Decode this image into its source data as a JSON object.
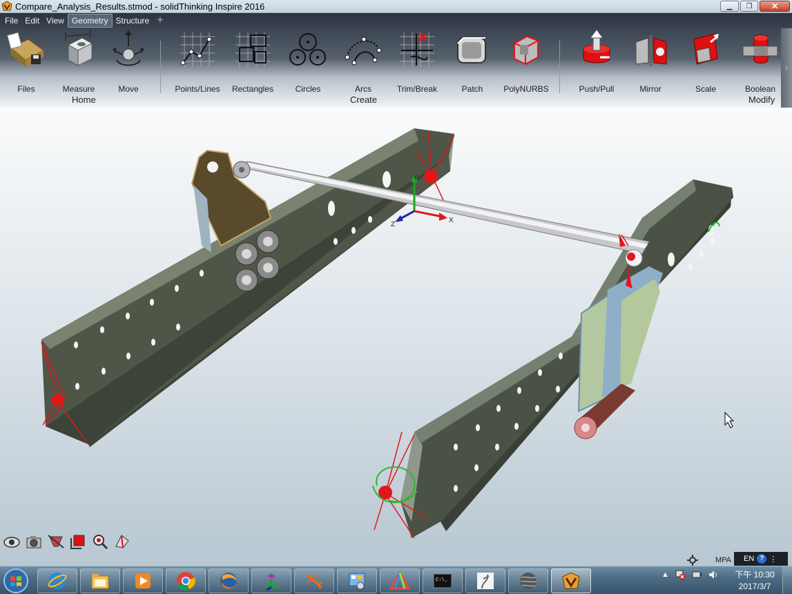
{
  "window": {
    "title": "Compare_Analysis_Results.stmod - solidThinking Inspire 2016",
    "min_label": "▁",
    "max_label": "❐",
    "close_label": "✕"
  },
  "menu": {
    "items": [
      "File",
      "Edit",
      "View",
      "Geometry",
      "Structure"
    ],
    "active": "Geometry",
    "add_tab": "+"
  },
  "ribbon": {
    "groups": {
      "home": "Home",
      "create": "Create",
      "modify": "Modify"
    },
    "tools": [
      {
        "label": "Files",
        "icon": "files-icon"
      },
      {
        "label": "Measure",
        "icon": "measure-icon"
      },
      {
        "label": "Move",
        "icon": "move-icon"
      },
      {
        "label": "Points/Lines",
        "icon": "points-lines-icon"
      },
      {
        "label": "Rectangles",
        "icon": "rectangles-icon"
      },
      {
        "label": "Circles",
        "icon": "circles-icon"
      },
      {
        "label": "Arcs",
        "icon": "arcs-icon"
      },
      {
        "label": "Trim/Break",
        "icon": "trim-break-icon"
      },
      {
        "label": "Patch",
        "icon": "patch-icon"
      },
      {
        "label": "PolyNURBS",
        "icon": "polynurbs-icon"
      },
      {
        "label": "Push/Pull",
        "icon": "push-pull-icon"
      },
      {
        "label": "Mirror",
        "icon": "mirror-icon"
      },
      {
        "label": "Scale",
        "icon": "scale-icon"
      },
      {
        "label": "Boolean",
        "icon": "boolean-icon"
      }
    ],
    "scroll_label": "›"
  },
  "viewport": {
    "axes": {
      "x": "X",
      "y": "Y",
      "z": "Z"
    },
    "unit_system": "MPA",
    "lang": "EN",
    "help": "?",
    "lang_menu": "⋮",
    "view_tools": [
      "eye-icon",
      "camera-icon",
      "section-cut-icon",
      "box-select-icon",
      "zoom-icon",
      "3d-view-icon"
    ]
  },
  "taskbar": {
    "apps": [
      "internet-explorer-icon",
      "file-explorer-icon",
      "media-player-icon",
      "chrome-icon",
      "firefox-icon",
      "coordinate-app-icon",
      "lizard-app-icon",
      "control-panel-icon",
      "triangle-app-icon",
      "command-prompt-icon",
      "figure-app-icon",
      "sphere-app-icon",
      "inspire-app-icon"
    ],
    "cmd_text": "C:\\_",
    "tray_arrow": "▲",
    "clock_time": "下午 10:30",
    "clock_date": "2017/3/7"
  },
  "colors": {
    "beam": "#4e5648",
    "accent_red": "#e01818",
    "ribbon_dark": "#3b4552"
  }
}
